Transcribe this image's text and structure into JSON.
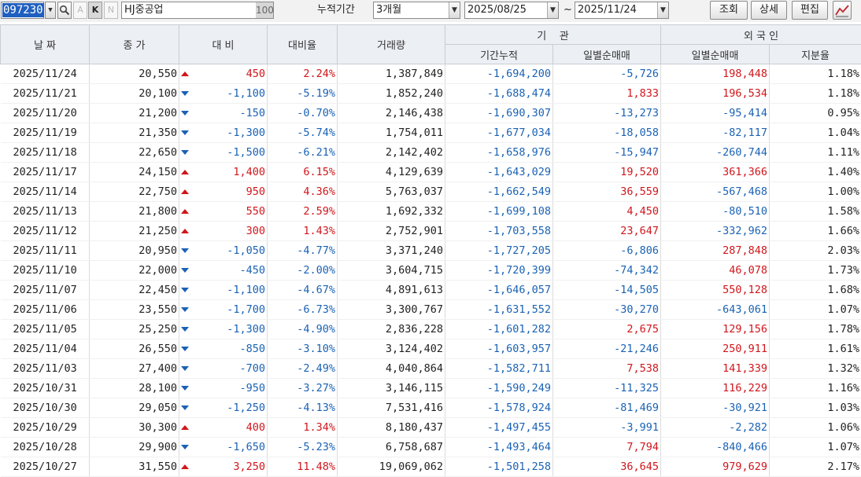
{
  "toolbar": {
    "stock_code": "097230",
    "btn_a": "A",
    "btn_k": "K",
    "btn_n": "N",
    "stock_name": "HJ중공업",
    "name_badge": "100",
    "period_label": "누적기간",
    "period_value": "3개월",
    "date_from": "2025/08/25",
    "tilde": "~",
    "date_to": "2025/11/24",
    "query_label": "조회",
    "detail_label": "상세",
    "edit_label": "편집"
  },
  "headers": {
    "date": "날 짜",
    "close": "종 가",
    "change": "대 비",
    "rate": "대비율",
    "volume": "거래량",
    "inst": "기    관",
    "inst_cum": "기간누적",
    "inst_daily": "일별순매매",
    "foreign": "외 국 인",
    "foreign_daily": "일별순매매",
    "foreign_share": "지분율"
  },
  "colors": {
    "up": "#d0161c",
    "down": "#1a62b4",
    "header_bg": "#eceff4"
  },
  "rows": [
    {
      "date": "2025/11/24",
      "close": "20,550",
      "chg": "450",
      "dir": "up",
      "rate": "2.24%",
      "vol": "1,387,849",
      "inst_cum": "-1,694,200",
      "inst_day": "-5,726",
      "for_day": "198,448",
      "share": "1.18%"
    },
    {
      "date": "2025/11/21",
      "close": "20,100",
      "chg": "-1,100",
      "dir": "down",
      "rate": "-5.19%",
      "vol": "1,852,240",
      "inst_cum": "-1,688,474",
      "inst_day": "1,833",
      "for_day": "196,534",
      "share": "1.18%"
    },
    {
      "date": "2025/11/20",
      "close": "21,200",
      "chg": "-150",
      "dir": "down",
      "rate": "-0.70%",
      "vol": "2,146,438",
      "inst_cum": "-1,690,307",
      "inst_day": "-13,273",
      "for_day": "-95,414",
      "share": "0.95%"
    },
    {
      "date": "2025/11/19",
      "close": "21,350",
      "chg": "-1,300",
      "dir": "down",
      "rate": "-5.74%",
      "vol": "1,754,011",
      "inst_cum": "-1,677,034",
      "inst_day": "-18,058",
      "for_day": "-82,117",
      "share": "1.04%"
    },
    {
      "date": "2025/11/18",
      "close": "22,650",
      "chg": "-1,500",
      "dir": "down",
      "rate": "-6.21%",
      "vol": "2,142,402",
      "inst_cum": "-1,658,976",
      "inst_day": "-15,947",
      "for_day": "-260,744",
      "share": "1.11%"
    },
    {
      "date": "2025/11/17",
      "close": "24,150",
      "chg": "1,400",
      "dir": "up",
      "rate": "6.15%",
      "vol": "4,129,639",
      "inst_cum": "-1,643,029",
      "inst_day": "19,520",
      "for_day": "361,366",
      "share": "1.40%"
    },
    {
      "date": "2025/11/14",
      "close": "22,750",
      "chg": "950",
      "dir": "up",
      "rate": "4.36%",
      "vol": "5,763,037",
      "inst_cum": "-1,662,549",
      "inst_day": "36,559",
      "for_day": "-567,468",
      "share": "1.00%"
    },
    {
      "date": "2025/11/13",
      "close": "21,800",
      "chg": "550",
      "dir": "up",
      "rate": "2.59%",
      "vol": "1,692,332",
      "inst_cum": "-1,699,108",
      "inst_day": "4,450",
      "for_day": "-80,510",
      "share": "1.58%"
    },
    {
      "date": "2025/11/12",
      "close": "21,250",
      "chg": "300",
      "dir": "up",
      "rate": "1.43%",
      "vol": "2,752,901",
      "inst_cum": "-1,703,558",
      "inst_day": "23,647",
      "for_day": "-332,962",
      "share": "1.66%"
    },
    {
      "date": "2025/11/11",
      "close": "20,950",
      "chg": "-1,050",
      "dir": "down",
      "rate": "-4.77%",
      "vol": "3,371,240",
      "inst_cum": "-1,727,205",
      "inst_day": "-6,806",
      "for_day": "287,848",
      "share": "2.03%"
    },
    {
      "date": "2025/11/10",
      "close": "22,000",
      "chg": "-450",
      "dir": "down",
      "rate": "-2.00%",
      "vol": "3,604,715",
      "inst_cum": "-1,720,399",
      "inst_day": "-74,342",
      "for_day": "46,078",
      "share": "1.73%"
    },
    {
      "date": "2025/11/07",
      "close": "22,450",
      "chg": "-1,100",
      "dir": "down",
      "rate": "-4.67%",
      "vol": "4,891,613",
      "inst_cum": "-1,646,057",
      "inst_day": "-14,505",
      "for_day": "550,128",
      "share": "1.68%"
    },
    {
      "date": "2025/11/06",
      "close": "23,550",
      "chg": "-1,700",
      "dir": "down",
      "rate": "-6.73%",
      "vol": "3,300,767",
      "inst_cum": "-1,631,552",
      "inst_day": "-30,270",
      "for_day": "-643,061",
      "share": "1.07%"
    },
    {
      "date": "2025/11/05",
      "close": "25,250",
      "chg": "-1,300",
      "dir": "down",
      "rate": "-4.90%",
      "vol": "2,836,228",
      "inst_cum": "-1,601,282",
      "inst_day": "2,675",
      "for_day": "129,156",
      "share": "1.78%"
    },
    {
      "date": "2025/11/04",
      "close": "26,550",
      "chg": "-850",
      "dir": "down",
      "rate": "-3.10%",
      "vol": "3,124,402",
      "inst_cum": "-1,603,957",
      "inst_day": "-21,246",
      "for_day": "250,911",
      "share": "1.61%"
    },
    {
      "date": "2025/11/03",
      "close": "27,400",
      "chg": "-700",
      "dir": "down",
      "rate": "-2.49%",
      "vol": "4,040,864",
      "inst_cum": "-1,582,711",
      "inst_day": "7,538",
      "for_day": "141,339",
      "share": "1.32%"
    },
    {
      "date": "2025/10/31",
      "close": "28,100",
      "chg": "-950",
      "dir": "down",
      "rate": "-3.27%",
      "vol": "3,146,115",
      "inst_cum": "-1,590,249",
      "inst_day": "-11,325",
      "for_day": "116,229",
      "share": "1.16%"
    },
    {
      "date": "2025/10/30",
      "close": "29,050",
      "chg": "-1,250",
      "dir": "down",
      "rate": "-4.13%",
      "vol": "7,531,416",
      "inst_cum": "-1,578,924",
      "inst_day": "-81,469",
      "for_day": "-30,921",
      "share": "1.03%"
    },
    {
      "date": "2025/10/29",
      "close": "30,300",
      "chg": "400",
      "dir": "up",
      "rate": "1.34%",
      "vol": "8,180,437",
      "inst_cum": "-1,497,455",
      "inst_day": "-3,991",
      "for_day": "-2,282",
      "share": "1.06%"
    },
    {
      "date": "2025/10/28",
      "close": "29,900",
      "chg": "-1,650",
      "dir": "down",
      "rate": "-5.23%",
      "vol": "6,758,687",
      "inst_cum": "-1,493,464",
      "inst_day": "7,794",
      "for_day": "-840,466",
      "share": "1.07%"
    },
    {
      "date": "2025/10/27",
      "close": "31,550",
      "chg": "3,250",
      "dir": "up",
      "rate": "11.48%",
      "vol": "19,069,062",
      "inst_cum": "-1,501,258",
      "inst_day": "36,645",
      "for_day": "979,629",
      "share": "2.17%"
    }
  ]
}
